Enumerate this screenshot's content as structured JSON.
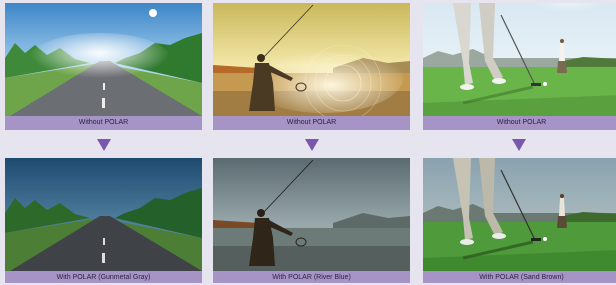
{
  "panels": [
    {
      "top_caption": "Without POLAR",
      "bottom_caption": "With POLAR  (Gunmetal Gray)",
      "scene": "road-icon"
    },
    {
      "top_caption": "Without POLAR",
      "bottom_caption": "With POLAR (River Blue)",
      "scene": "fisherman-icon"
    },
    {
      "top_caption": "Without POLAR",
      "bottom_caption": "With POLAR (Sand Brown)",
      "scene": "golfer-icon"
    }
  ],
  "colors": {
    "label_bg": "#a694c6",
    "arrow": "#7a56ad",
    "page_bg": "#e6e4ee"
  }
}
